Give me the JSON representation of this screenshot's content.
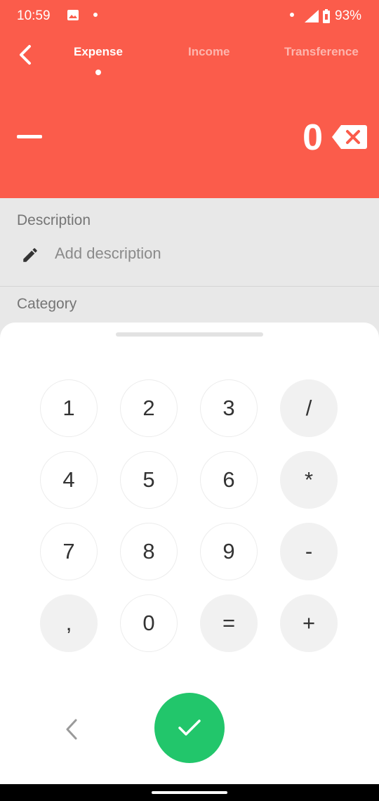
{
  "colors": {
    "accent": "#fb5c4b",
    "confirm": "#22c66b",
    "sheet_background": "#ffffff",
    "page_background": "#e8e8e8"
  },
  "status_bar": {
    "time": "10:59",
    "battery": "93%",
    "icons": [
      "image-icon",
      "dot-icon",
      "dot-icon",
      "signal-icon",
      "battery-icon"
    ]
  },
  "header": {
    "back_icon": "chevron-left-icon",
    "tabs": [
      {
        "label": "Expense",
        "active": true
      },
      {
        "label": "Income",
        "active": false
      },
      {
        "label": "Transference",
        "active": false
      }
    ]
  },
  "amount": {
    "sign_icon": "minus-icon",
    "value": "0",
    "backspace_icon": "backspace-icon"
  },
  "description": {
    "label": "Description",
    "placeholder": "Add description",
    "icon": "pencil-icon"
  },
  "category": {
    "label": "Category"
  },
  "keypad": {
    "keys": [
      {
        "label": "1",
        "type": "digit"
      },
      {
        "label": "2",
        "type": "digit"
      },
      {
        "label": "3",
        "type": "digit"
      },
      {
        "label": "/",
        "type": "op"
      },
      {
        "label": "4",
        "type": "digit"
      },
      {
        "label": "5",
        "type": "digit"
      },
      {
        "label": "6",
        "type": "digit"
      },
      {
        "label": "*",
        "type": "op"
      },
      {
        "label": "7",
        "type": "digit"
      },
      {
        "label": "8",
        "type": "digit"
      },
      {
        "label": "9",
        "type": "digit"
      },
      {
        "label": "-",
        "type": "op"
      },
      {
        "label": ",",
        "type": "op"
      },
      {
        "label": "0",
        "type": "digit"
      },
      {
        "label": "=",
        "type": "op"
      },
      {
        "label": "+",
        "type": "op"
      }
    ]
  },
  "footer": {
    "prev_icon": "chevron-left-icon",
    "confirm_icon": "check-icon"
  }
}
